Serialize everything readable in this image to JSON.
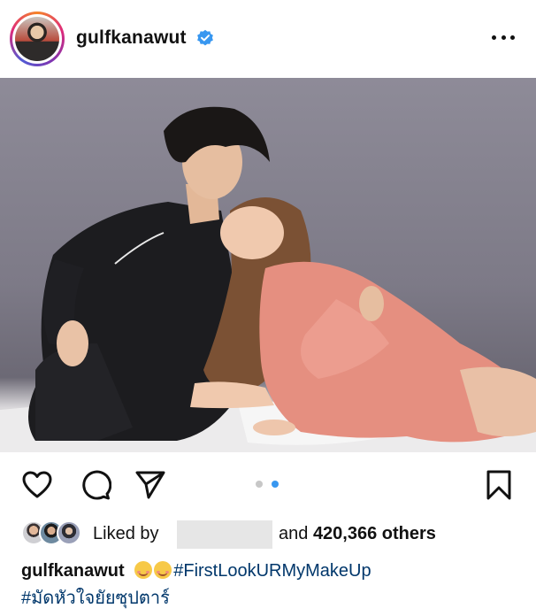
{
  "post": {
    "username": "gulfkanawut",
    "verified_icon": "verified-badge-icon",
    "more_icon": "more-options-icon"
  },
  "actions": {
    "like_icon": "heart-icon",
    "comment_icon": "comment-icon",
    "share_icon": "send-icon",
    "save_icon": "bookmark-icon",
    "carousel_total": 2,
    "carousel_active": 2
  },
  "likes": {
    "liked_by_label": "Liked by",
    "liked_user_hidden": "",
    "and_label": "and",
    "count": "420,366",
    "others_label": "others"
  },
  "caption": {
    "username": "gulfkanawut",
    "hashtag1": "#FirstLookURMyMakeUp",
    "hashtag2": "#มัดหัวใจยัยซุปตาร์"
  },
  "colors": {
    "hashtag": "#00376b",
    "verified": "#3897f0",
    "dot_active": "#3897f0",
    "dot_inactive": "#c7c7c7"
  }
}
